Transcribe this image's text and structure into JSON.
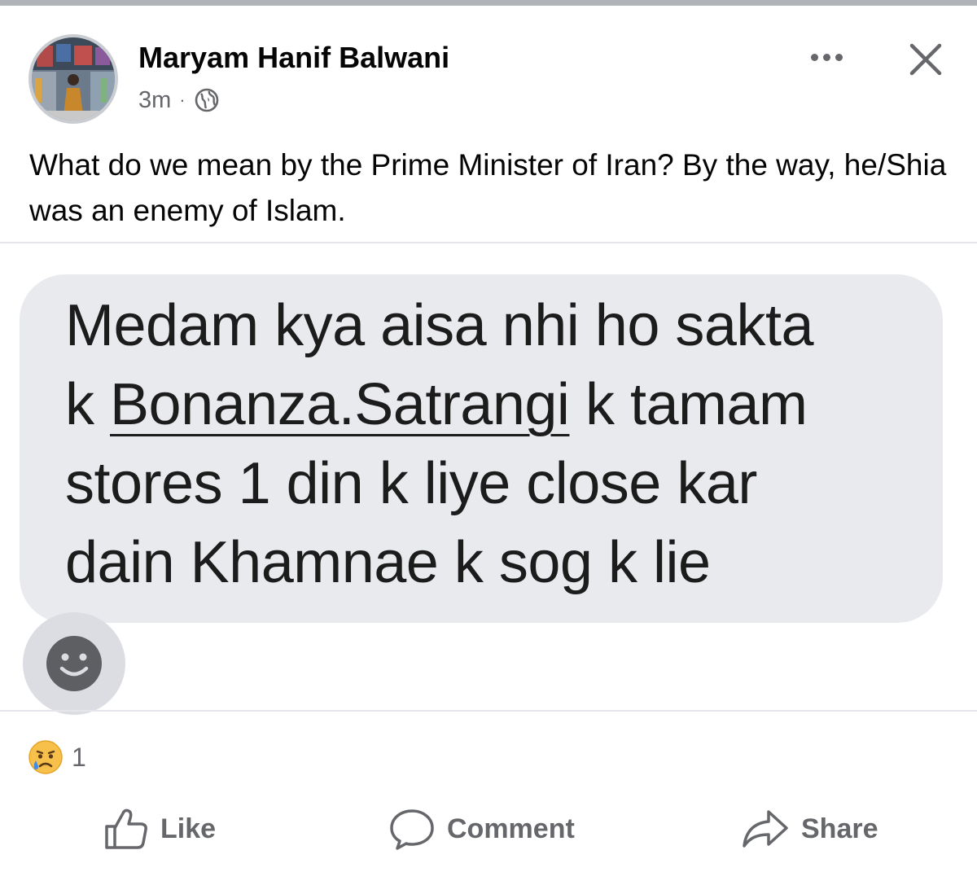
{
  "post": {
    "author": "Maryam Hanif Balwani",
    "time": "3m",
    "separator": "·",
    "audience_icon": "globe-icon",
    "caption": "What do we mean by the Prime Minister of Iran? By the way, he/Shia was an enemy of Islam."
  },
  "header_actions": {
    "more_icon": "more-dots-icon",
    "close_icon": "close-icon"
  },
  "shared_message": {
    "line1": "Medam kya aisa nhi ho sakta",
    "line2_prefix": "k ",
    "line2_link": "Bonanza.Satrangi",
    "line2_suffix": " k tamam",
    "line3": "stores 1 din k liye close kar",
    "line4": "dain Khamnae k sog k lie",
    "emoji_button_icon": "smiley-face-icon"
  },
  "reactions": {
    "icon": "sad-crying-face-icon",
    "count": "1"
  },
  "actions": {
    "like": "Like",
    "comment": "Comment",
    "share": "Share"
  },
  "colors": {
    "secondary_text": "#65676b",
    "bubble_background": "#e9eaee",
    "divider": "#e4e6eb"
  }
}
